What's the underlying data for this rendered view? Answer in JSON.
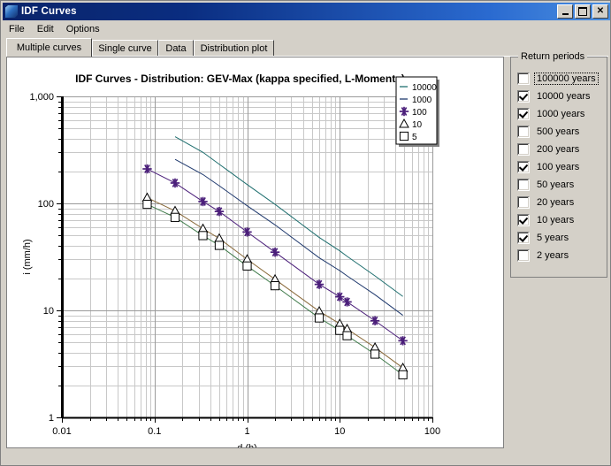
{
  "window": {
    "title": "IDF Curves",
    "icon": "app-icon",
    "buttons": {
      "minimize": "minimize-icon",
      "maximize": "maximize-icon",
      "close": "close-icon"
    }
  },
  "menu": {
    "items": [
      {
        "label": "File"
      },
      {
        "label": "Edit"
      },
      {
        "label": "Options"
      }
    ]
  },
  "tabs": [
    {
      "label": "Multiple curves",
      "active": true
    },
    {
      "label": "Single curve",
      "active": false
    },
    {
      "label": "Data",
      "active": false
    },
    {
      "label": "Distribution plot",
      "active": false
    }
  ],
  "return_periods": {
    "title": "Return periods",
    "items": [
      {
        "label": "100000 years",
        "checked": false,
        "focused": true
      },
      {
        "label": "10000 years",
        "checked": true,
        "focused": false
      },
      {
        "label": "1000 years",
        "checked": true,
        "focused": false
      },
      {
        "label": "500 years",
        "checked": false,
        "focused": false
      },
      {
        "label": "200 years",
        "checked": false,
        "focused": false
      },
      {
        "label": "100 years",
        "checked": true,
        "focused": false
      },
      {
        "label": "50 years",
        "checked": false,
        "focused": false
      },
      {
        "label": "20 years",
        "checked": false,
        "focused": false
      },
      {
        "label": "10 years",
        "checked": true,
        "focused": false
      },
      {
        "label": "5 years",
        "checked": true,
        "focused": false
      },
      {
        "label": "2 years",
        "checked": false,
        "focused": false
      }
    ]
  },
  "chart_data": {
    "type": "line",
    "title": "IDF Curves - Distribution: GEV-Max (kappa specified, L-Moments)",
    "xlabel": "d (h)",
    "ylabel": "i (mm/h)",
    "xscale": "log",
    "yscale": "log",
    "xlim": [
      0.01,
      100
    ],
    "ylim": [
      1,
      1000
    ],
    "xticks": [
      "0.01",
      "0.1",
      "1",
      "10",
      "100"
    ],
    "yticks": [
      "1",
      "10",
      "100",
      "1,000"
    ],
    "grid": true,
    "legend_position": "top-right-outside",
    "legend": [
      {
        "name": "10000",
        "marker": "dash",
        "color": "#1f6f6f"
      },
      {
        "name": "1000",
        "marker": "dash",
        "color": "#203a6e"
      },
      {
        "name": "100",
        "marker": "asterisk",
        "color": "#4b1f7a"
      },
      {
        "name": "10",
        "marker": "triangle",
        "color": "#8a6a3a"
      },
      {
        "name": "5",
        "marker": "square",
        "color": "#3f7a4a"
      }
    ],
    "x": [
      0.0833,
      0.1667,
      0.3333,
      0.5,
      1,
      2,
      6,
      10,
      12,
      24,
      48
    ],
    "series": [
      {
        "name": "10000",
        "label": "10000 years",
        "color": "#1f6f6f",
        "marker": "none",
        "values": [
          null,
          420,
          300,
          232,
          150,
          98,
          48,
          36,
          32,
          21,
          13.5
        ]
      },
      {
        "name": "1000",
        "label": "1000 years",
        "color": "#203a6e",
        "marker": "none",
        "values": [
          null,
          258,
          186,
          146,
          95,
          63,
          31,
          23.5,
          21,
          14,
          9.0
        ]
      },
      {
        "name": "100",
        "label": "100 years",
        "color": "#4b1f7a",
        "marker": "asterisk",
        "values": [
          210,
          155,
          104,
          84,
          54,
          35,
          17.5,
          13.4,
          12.0,
          8.0,
          5.2
        ]
      },
      {
        "name": "10",
        "label": "10 years",
        "color": "#8a6a3a",
        "marker": "triangle",
        "values": [
          113,
          85,
          58,
          47,
          30,
          19.5,
          9.8,
          7.5,
          6.7,
          4.5,
          2.9
        ]
      },
      {
        "name": "5",
        "label": "5 years",
        "color": "#3f7a4a",
        "marker": "square",
        "values": [
          98,
          74,
          50,
          40.5,
          26,
          17.0,
          8.5,
          6.5,
          5.8,
          3.9,
          2.5
        ]
      }
    ]
  }
}
